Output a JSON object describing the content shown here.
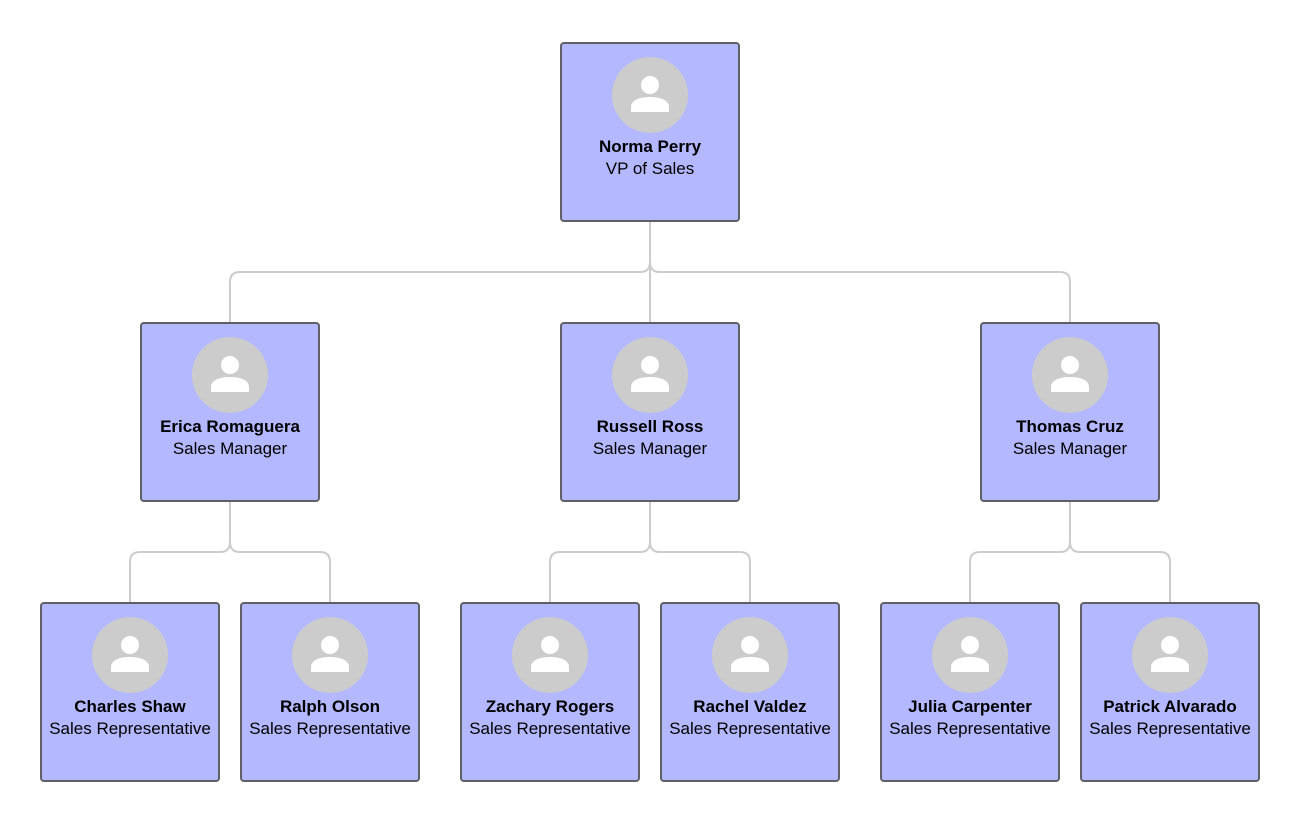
{
  "chart": {
    "type": "org-chart",
    "colors": {
      "card_fill": "#b3b8ff",
      "card_border": "#5f5f66",
      "connector": "#cccccc",
      "avatar_bg": "#cccccc",
      "avatar_glyph": "#ffffff"
    }
  },
  "people": [
    {
      "id": "norma",
      "name": "Norma Perry",
      "title": "VP of Sales",
      "manager": null,
      "avatar_icon": "person-icon"
    },
    {
      "id": "erica",
      "name": "Erica Romaguera",
      "title": "Sales Manager",
      "manager": "norma",
      "avatar_icon": "person-icon"
    },
    {
      "id": "russell",
      "name": "Russell Ross",
      "title": "Sales Manager",
      "manager": "norma",
      "avatar_icon": "person-icon"
    },
    {
      "id": "thomas",
      "name": "Thomas Cruz",
      "title": "Sales Manager",
      "manager": "norma",
      "avatar_icon": "person-icon"
    },
    {
      "id": "charles",
      "name": "Charles Shaw",
      "title": "Sales Representative",
      "manager": "erica",
      "avatar_icon": "person-icon"
    },
    {
      "id": "ralph",
      "name": "Ralph Olson",
      "title": "Sales Representative",
      "manager": "erica",
      "avatar_icon": "person-icon"
    },
    {
      "id": "zachary",
      "name": "Zachary Rogers",
      "title": "Sales Representative",
      "manager": "russell",
      "avatar_icon": "person-icon"
    },
    {
      "id": "rachel",
      "name": "Rachel Valdez",
      "title": "Sales Representative",
      "manager": "russell",
      "avatar_icon": "person-icon"
    },
    {
      "id": "julia",
      "name": "Julia Carpenter",
      "title": "Sales Representative",
      "manager": "thomas",
      "avatar_icon": "person-icon"
    },
    {
      "id": "patrick",
      "name": "Patrick Alvarado",
      "title": "Sales Representative",
      "manager": "thomas",
      "avatar_icon": "person-icon"
    }
  ]
}
